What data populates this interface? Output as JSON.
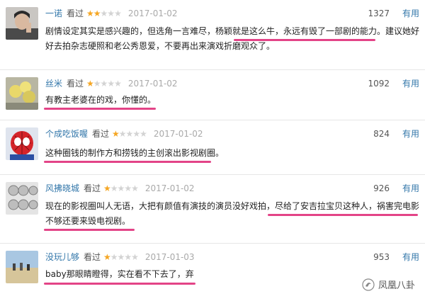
{
  "reviews": [
    {
      "user": "一诺",
      "watched": "看过",
      "rating": 2,
      "date": "2017-01-02",
      "votes": "1327",
      "useful_label": "有用",
      "text_line1": "剧情设定其实是感兴趣的，但选角一言难尽，杨颖就是这么牛，永远有毁了一部剧的能力。建议她好",
      "text_line2": "好去拍杂志硬照和老公秀恩爱，不要再出来演戏折磨观众了。"
    },
    {
      "user": "丝米",
      "watched": "看过",
      "rating": 1,
      "date": "2017-01-02",
      "votes": "1092",
      "useful_label": "有用",
      "text_line1": "有教主老婆在的戏，你懂的。"
    },
    {
      "user": "个成吃饭喔",
      "watched": "看过",
      "rating": 1,
      "date": "2017-01-02",
      "votes": "824",
      "useful_label": "有用",
      "text_line1": "这种圈钱的制作方和捞钱的主创滚出影视剧圈。"
    },
    {
      "user": "风拂晓城",
      "watched": "看过",
      "rating": 1,
      "date": "2017-01-02",
      "votes": "926",
      "useful_label": "有用",
      "text_line1": "现在的影视圈叫人无语，大把有颜值有演技的演员没好戏拍，尽给了安吉拉宝贝这种人，祸害完电影",
      "text_line2": "不够还要来毁电视剧。"
    },
    {
      "user": "没玩儿够",
      "watched": "看过",
      "rating": 1,
      "date": "2017-01-03",
      "votes": "953",
      "useful_label": "有用",
      "text_line1": "baby那眼睛瞪得，实在看不下去了，弃"
    }
  ],
  "watermark": {
    "text": "凤凰八卦"
  },
  "colors": {
    "link": "#3377aa",
    "star": "#f5a623",
    "highlight": "#e0307a"
  }
}
